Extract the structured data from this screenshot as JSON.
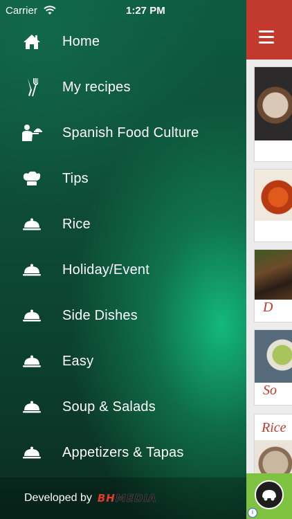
{
  "status_bar": {
    "carrier": "Carrier",
    "time": "1:27 PM"
  },
  "menu": {
    "items": [
      {
        "label": "Home",
        "icon": "home-icon"
      },
      {
        "label": "My recipes",
        "icon": "fork-knife-icon"
      },
      {
        "label": "Spanish Food Culture",
        "icon": "waiter-icon"
      },
      {
        "label": "Tips",
        "icon": "chef-hat-icon"
      },
      {
        "label": "Rice",
        "icon": "cloche-icon"
      },
      {
        "label": "Holiday/Event",
        "icon": "cloche-icon"
      },
      {
        "label": "Side Dishes",
        "icon": "cloche-icon"
      },
      {
        "label": "Easy",
        "icon": "cloche-icon"
      },
      {
        "label": "Soup & Salads",
        "icon": "cloche-icon"
      },
      {
        "label": "Appetizers & Tapas",
        "icon": "cloche-icon"
      }
    ]
  },
  "footer": {
    "developed_by": "Developed by",
    "brand_part1": "BH",
    "brand_part2": "MEDIA"
  },
  "content": {
    "card_labels": [
      "D",
      "So",
      "Rice"
    ],
    "accent_color": "#c23a2e"
  },
  "ad": {
    "info": "i"
  }
}
